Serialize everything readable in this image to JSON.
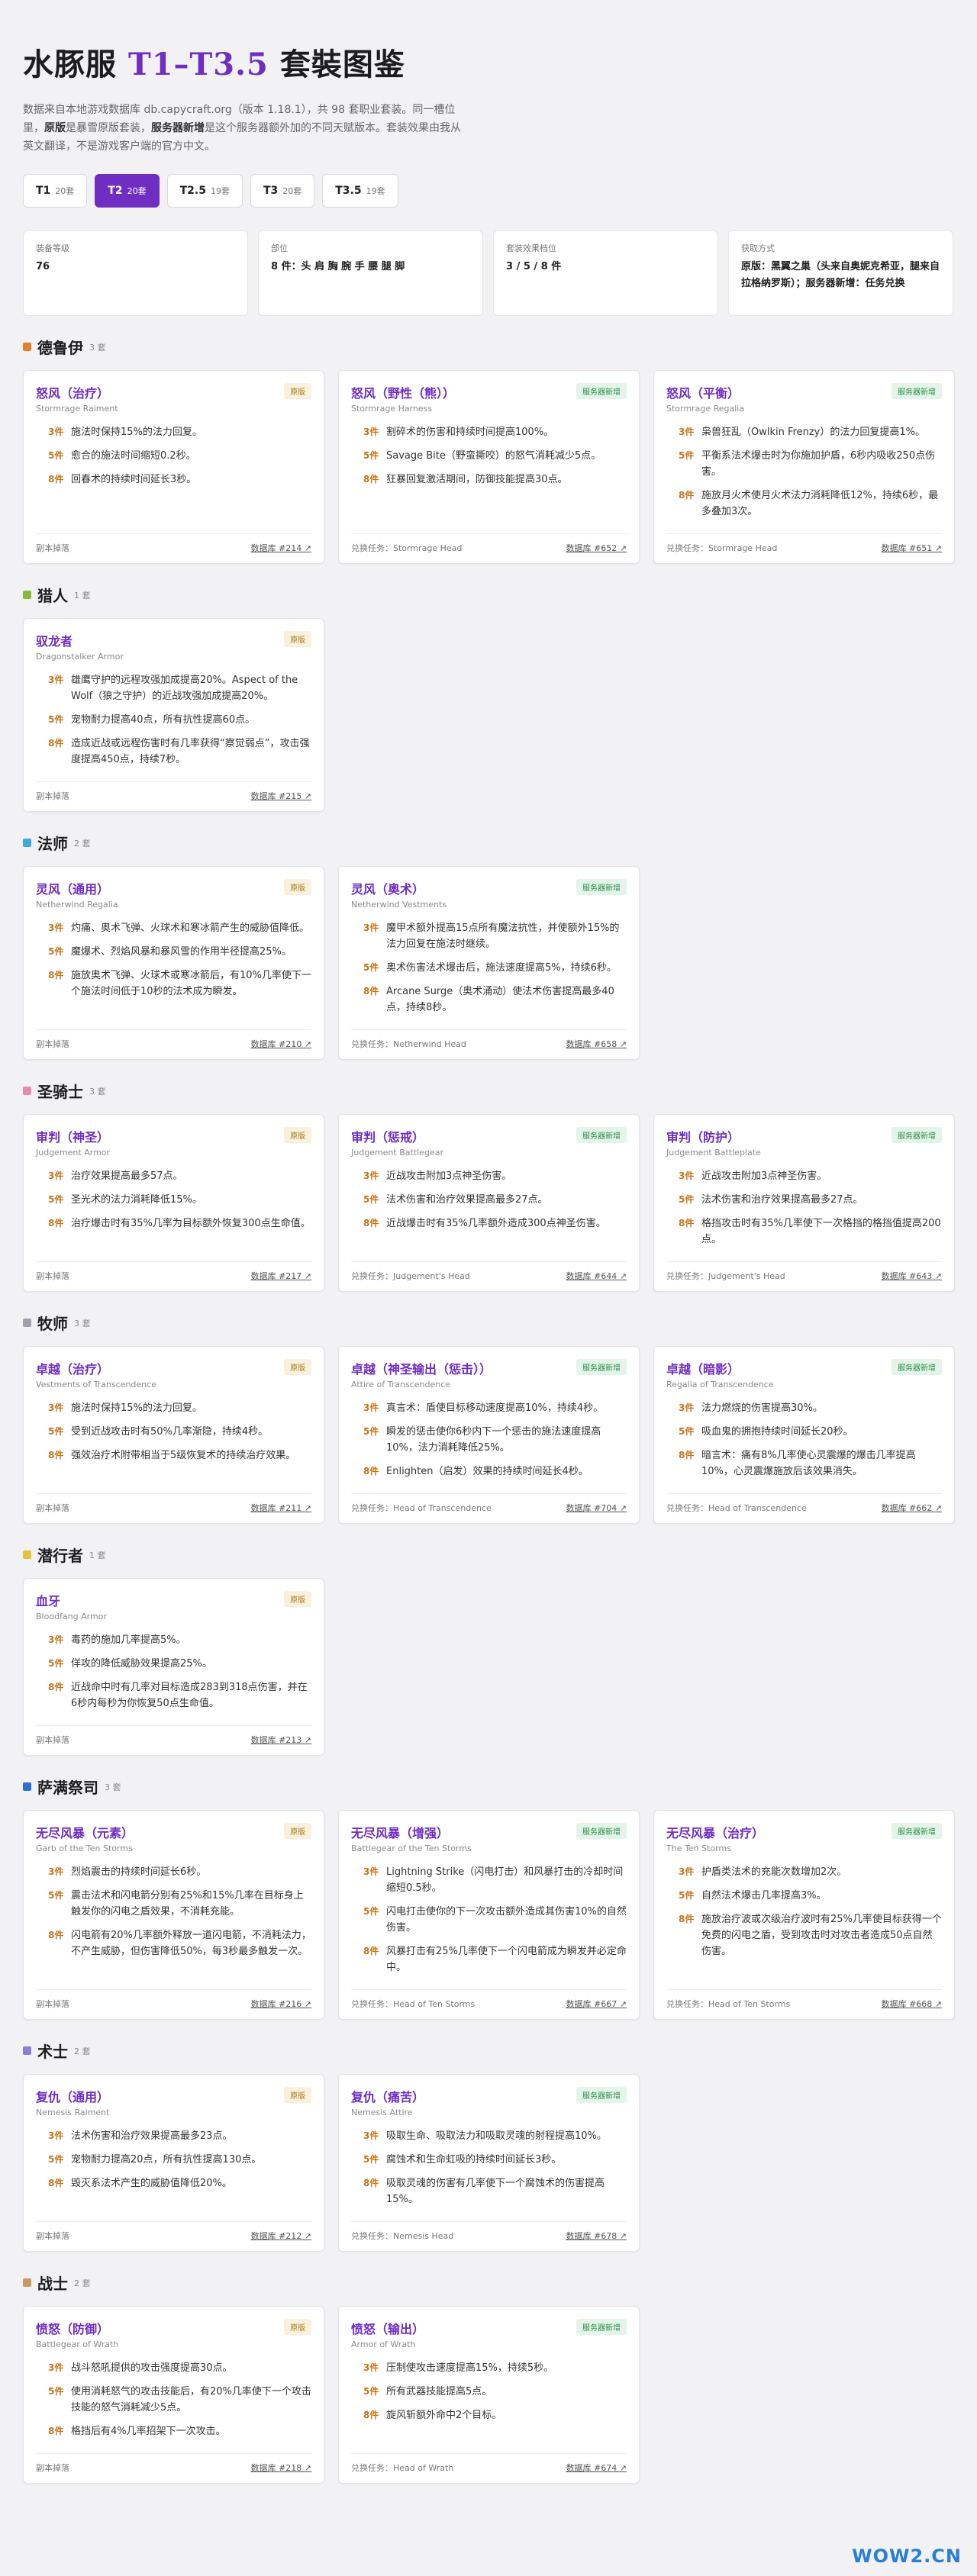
{
  "title": {
    "prefix": "水豚服 ",
    "accent": "T1–T3.5",
    "suffix": " 套裝图鉴"
  },
  "intro": {
    "p1": "数据来自本地游戏数据库 db.capycraft.org（版本 1.18.1），共 98 套职业套装。同一槽位里，",
    "b1": "原版",
    "p2": "是暴雪原版套装，",
    "b2": "服务器新增",
    "p3": "是这个服务器额外加的不同天赋版本。套装效果由我从英文翻译，不是游戏客户端的官方中文。"
  },
  "tabs": [
    {
      "name": "T1",
      "count": "20套"
    },
    {
      "name": "T2",
      "count": "20套"
    },
    {
      "name": "T2.5",
      "count": "19套"
    },
    {
      "name": "T3",
      "count": "20套"
    },
    {
      "name": "T3.5",
      "count": "19套"
    }
  ],
  "active_tab": 1,
  "info": [
    {
      "k": "装备等级",
      "v": "76"
    },
    {
      "k": "部位",
      "v": "8 件：头 肩 胸 腕 手 腰 腿 脚"
    },
    {
      "k": "套装效果档位",
      "v": "3 / 5 / 8 件"
    },
    {
      "k": "获取方式",
      "v": "原版：黑翼之巢（头来自奥妮克希亚，腿来自拉格纳罗斯）；服务器新增：任务兑换"
    }
  ],
  "colors": {
    "accent": "#6f2dc2",
    "pieces": "#c4751a"
  },
  "classes": [
    {
      "name": "德鲁伊",
      "count": "3 套",
      "color": "#e87e2b",
      "cards": [
        {
          "title": "怒风（治疗）",
          "en": "Stormrage Raiment",
          "badge": "原版",
          "type": "orig",
          "bonuses": [
            {
              "p": "3件",
              "t": "施法时保持15%的法力回复。"
            },
            {
              "p": "5件",
              "t": "愈合的施法时间缩短0.2秒。"
            },
            {
              "p": "8件",
              "t": "回春术的持续时间延长3秒。"
            }
          ],
          "source": "副本掉落",
          "link": "数据库 #214 ↗"
        },
        {
          "title": "怒风（野性（熊））",
          "en": "Stormrage Harness",
          "badge": "服务器新增",
          "type": "new",
          "bonuses": [
            {
              "p": "3件",
              "t": "割碎术的伤害和持续时间提高100%。"
            },
            {
              "p": "5件",
              "t": "Savage Bite（野蛮撕咬）的怒气消耗减少5点。"
            },
            {
              "p": "8件",
              "t": "狂暴回复激活期间，防御技能提高30点。"
            }
          ],
          "source": "兑换任务：Stormrage Head",
          "link": "数据库 #652 ↗"
        },
        {
          "title": "怒风（平衡）",
          "en": "Stormrage Regalia",
          "badge": "服务器新增",
          "type": "new",
          "bonuses": [
            {
              "p": "3件",
              "t": "枭兽狂乱（Owlkin Frenzy）的法力回复提高1%。"
            },
            {
              "p": "5件",
              "t": "平衡系法术爆击时为你施加护盾，6秒内吸收250点伤害。"
            },
            {
              "p": "8件",
              "t": "施放月火术使月火术法力消耗降低12%，持续6秒，最多叠加3次。"
            }
          ],
          "source": "兑换任务：Stormrage Head",
          "link": "数据库 #651 ↗"
        }
      ]
    },
    {
      "name": "猎人",
      "count": "1 套",
      "color": "#8ab83f",
      "cards": [
        {
          "title": "驭龙者",
          "en": "Dragonstalker Armor",
          "badge": "原版",
          "type": "orig",
          "bonuses": [
            {
              "p": "3件",
              "t": "雄鹰守护的远程攻强加成提高20%。Aspect of the Wolf（狼之守护）的近战攻强加成提高20%。"
            },
            {
              "p": "5件",
              "t": "宠物耐力提高40点，所有抗性提高60点。"
            },
            {
              "p": "8件",
              "t": "造成近战或远程伤害时有几率获得“察觉弱点”，攻击强度提高450点，持续7秒。"
            }
          ],
          "source": "副本掉落",
          "link": "数据库 #215 ↗"
        }
      ]
    },
    {
      "name": "法师",
      "count": "2 套",
      "color": "#3fa8d8",
      "cards": [
        {
          "title": "灵风（通用）",
          "en": "Netherwind Regalia",
          "badge": "原版",
          "type": "orig",
          "bonuses": [
            {
              "p": "3件",
              "t": "灼痛、奥术飞弹、火球术和寒冰箭产生的威胁值降低。"
            },
            {
              "p": "5件",
              "t": "魔爆术、烈焰风暴和暴风雪的作用半径提高25%。"
            },
            {
              "p": "8件",
              "t": "施放奥术飞弹、火球术或寒冰箭后，有10%几率使下一个施法时间低于10秒的法术成为瞬发。"
            }
          ],
          "source": "副本掉落",
          "link": "数据库 #210 ↗"
        },
        {
          "title": "灵风（奥术）",
          "en": "Netherwind Vestments",
          "badge": "服务器新增",
          "type": "new",
          "bonuses": [
            {
              "p": "3件",
              "t": "魔甲术额外提高15点所有魔法抗性，并使额外15%的法力回复在施法时继续。"
            },
            {
              "p": "5件",
              "t": "奥术伤害法术爆击后，施法速度提高5%，持续6秒。"
            },
            {
              "p": "8件",
              "t": "Arcane Surge（奥术涌动）使法术伤害提高最多40点，持续8秒。"
            }
          ],
          "source": "兑换任务：Netherwind Head",
          "link": "数据库 #658 ↗"
        }
      ]
    },
    {
      "name": "圣骑士",
      "count": "3 套",
      "color": "#e88ab0",
      "cards": [
        {
          "title": "审判（神圣）",
          "en": "Judgement Armor",
          "badge": "原版",
          "type": "orig",
          "bonuses": [
            {
              "p": "3件",
              "t": "治疗效果提高最多57点。"
            },
            {
              "p": "5件",
              "t": "圣光术的法力消耗降低15%。"
            },
            {
              "p": "8件",
              "t": "治疗爆击时有35%几率为目标额外恢复300点生命值。"
            }
          ],
          "source": "副本掉落",
          "link": "数据库 #217 ↗"
        },
        {
          "title": "审判（惩戒）",
          "en": "Judgement Battlegear",
          "badge": "服务器新增",
          "type": "new",
          "bonuses": [
            {
              "p": "3件",
              "t": "近战攻击附加3点神圣伤害。"
            },
            {
              "p": "5件",
              "t": "法术伤害和治疗效果提高最多27点。"
            },
            {
              "p": "8件",
              "t": "近战爆击时有35%几率额外造成300点神圣伤害。"
            }
          ],
          "source": "兑换任务：Judgement's Head",
          "link": "数据库 #644 ↗"
        },
        {
          "title": "审判（防护）",
          "en": "Judgement Battleplate",
          "badge": "服务器新增",
          "type": "new",
          "bonuses": [
            {
              "p": "3件",
              "t": "近战攻击附加3点神圣伤害。"
            },
            {
              "p": "5件",
              "t": "法术伤害和治疗效果提高最多27点。"
            },
            {
              "p": "8件",
              "t": "格挡攻击时有35%几率使下一次格挡的格挡值提高200点。"
            }
          ],
          "source": "兑换任务：Judgement's Head",
          "link": "数据库 #643 ↗"
        }
      ]
    },
    {
      "name": "牧师",
      "count": "3 套",
      "color": "#a0a0a8",
      "cards": [
        {
          "title": "卓越（治疗）",
          "en": "Vestments of Transcendence",
          "badge": "原版",
          "type": "orig",
          "bonuses": [
            {
              "p": "3件",
              "t": "施法时保持15%的法力回复。"
            },
            {
              "p": "5件",
              "t": "受到近战攻击时有50%几率渐隐，持续4秒。"
            },
            {
              "p": "8件",
              "t": "强效治疗术附带相当于5级恢复术的持续治疗效果。"
            }
          ],
          "source": "副本掉落",
          "link": "数据库 #211 ↗"
        },
        {
          "title": "卓越（神圣输出（惩击））",
          "en": "Attire of Transcendence",
          "badge": "服务器新增",
          "type": "new",
          "bonuses": [
            {
              "p": "3件",
              "t": "真言术：盾使目标移动速度提高10%，持续4秒。"
            },
            {
              "p": "5件",
              "t": "瞬发的惩击使你6秒内下一个惩击的施法速度提高10%，法力消耗降低25%。"
            },
            {
              "p": "8件",
              "t": "Enlighten（启发）效果的持续时间延长4秒。"
            }
          ],
          "source": "兑换任务：Head of Transcendence",
          "link": "数据库 #704 ↗"
        },
        {
          "title": "卓越（暗影）",
          "en": "Regalia of Transcendence",
          "badge": "服务器新增",
          "type": "new",
          "bonuses": [
            {
              "p": "3件",
              "t": "法力燃烧的伤害提高30%。"
            },
            {
              "p": "5件",
              "t": "吸血鬼的拥抱持续时间延长20秒。"
            },
            {
              "p": "8件",
              "t": "暗言术：痛有8%几率使心灵震爆的爆击几率提高10%，心灵震爆施放后该效果消失。"
            }
          ],
          "source": "兑换任务：Head of Transcendence",
          "link": "数据库 #662 ↗"
        }
      ]
    },
    {
      "name": "潜行者",
      "count": "1 套",
      "color": "#e6c13a",
      "cards": [
        {
          "title": "血牙",
          "en": "Bloodfang Armor",
          "badge": "原版",
          "type": "orig",
          "bonuses": [
            {
              "p": "3件",
              "t": "毒药的施加几率提高5%。"
            },
            {
              "p": "5件",
              "t": "佯攻的降低威胁效果提高25%。"
            },
            {
              "p": "8件",
              "t": "近战命中时有几率对目标造成283到318点伤害，并在6秒内每秒为你恢复50点生命值。"
            }
          ],
          "source": "副本掉落",
          "link": "数据库 #213 ↗"
        }
      ]
    },
    {
      "name": "萨满祭司",
      "count": "3 套",
      "color": "#2a6fd4",
      "cards": [
        {
          "title": "无尽风暴（元素）",
          "en": "Garb of the Ten Storms",
          "badge": "原版",
          "type": "orig",
          "bonuses": [
            {
              "p": "3件",
              "t": "烈焰震击的持续时间延长6秒。"
            },
            {
              "p": "5件",
              "t": "震击法术和闪电箭分别有25%和15%几率在目标身上触发你的闪电之盾效果，不消耗充能。"
            },
            {
              "p": "8件",
              "t": "闪电箭有20%几率额外释放一道闪电箭，不消耗法力，不产生威胁，但伤害降低50%，每3秒最多触发一次。"
            }
          ],
          "source": "副本掉落",
          "link": "数据库 #216 ↗"
        },
        {
          "title": "无尽风暴（增强）",
          "en": "Battlegear of the Ten Storms",
          "badge": "服务器新增",
          "type": "new",
          "bonuses": [
            {
              "p": "3件",
              "t": "Lightning Strike（闪电打击）和风暴打击的冷却时间缩短0.5秒。"
            },
            {
              "p": "5件",
              "t": "闪电打击使你的下一次攻击额外造成其伤害10%的自然伤害。"
            },
            {
              "p": "8件",
              "t": "风暴打击有25%几率使下一个闪电箭成为瞬发并必定命中。"
            }
          ],
          "source": "兑换任务：Head of Ten Storms",
          "link": "数据库 #667 ↗"
        },
        {
          "title": "无尽风暴（治疗）",
          "en": "The Ten Storms",
          "badge": "服务器新增",
          "type": "new",
          "bonuses": [
            {
              "p": "3件",
              "t": "护盾类法术的充能次数增加2次。"
            },
            {
              "p": "5件",
              "t": "自然法术爆击几率提高3%。"
            },
            {
              "p": "8件",
              "t": "施放治疗波或次级治疗波时有25%几率使目标获得一个免费的闪电之盾，受到攻击时对攻击者造成50点自然伤害。"
            }
          ],
          "source": "兑换任务：Head of Ten Storms",
          "link": "数据库 #668 ↗"
        }
      ]
    },
    {
      "name": "术士",
      "count": "2 套",
      "color": "#8b7cd6",
      "cards": [
        {
          "title": "复仇（通用）",
          "en": "Nemesis Raiment",
          "badge": "原版",
          "type": "orig",
          "bonuses": [
            {
              "p": "3件",
              "t": "法术伤害和治疗效果提高最多23点。"
            },
            {
              "p": "5件",
              "t": "宠物耐力提高20点，所有抗性提高130点。"
            },
            {
              "p": "8件",
              "t": "毁灭系法术产生的威胁值降低20%。"
            }
          ],
          "source": "副本掉落",
          "link": "数据库 #212 ↗"
        },
        {
          "title": "复仇（痛苦）",
          "en": "Nemesis Attire",
          "badge": "服务器新增",
          "type": "new",
          "bonuses": [
            {
              "p": "3件",
              "t": "吸取生命、吸取法力和吸取灵魂的射程提高10%。"
            },
            {
              "p": "5件",
              "t": "腐蚀术和生命虹吸的持续时间延长3秒。"
            },
            {
              "p": "8件",
              "t": "吸取灵魂的伤害有几率使下一个腐蚀术的伤害提高15%。"
            }
          ],
          "source": "兑换任务：Nemesis Head",
          "link": "数据库 #678 ↗"
        }
      ]
    },
    {
      "name": "战士",
      "count": "2 套",
      "color": "#c89a62",
      "cards": [
        {
          "title": "愤怒（防御）",
          "en": "Battlegear of Wrath",
          "badge": "原版",
          "type": "orig",
          "bonuses": [
            {
              "p": "3件",
              "t": "战斗怒吼提供的攻击强度提高30点。"
            },
            {
              "p": "5件",
              "t": "使用消耗怒气的攻击技能后，有20%几率使下一个攻击技能的怒气消耗减少5点。"
            },
            {
              "p": "8件",
              "t": "格挡后有4%几率招架下一次攻击。"
            }
          ],
          "source": "副本掉落",
          "link": "数据库 #218 ↗"
        },
        {
          "title": "愤怒（输出）",
          "en": "Armor of Wrath",
          "badge": "服务器新增",
          "type": "new",
          "bonuses": [
            {
              "p": "3件",
              "t": "压制使攻击速度提高15%，持续5秒。"
            },
            {
              "p": "5件",
              "t": "所有武器技能提高5点。"
            },
            {
              "p": "8件",
              "t": "旋风斩额外命中2个目标。"
            }
          ],
          "source": "兑换任务：Head of Wrath",
          "link": "数据库 #674 ↗"
        }
      ]
    }
  ],
  "watermark": "WOW2.CN"
}
